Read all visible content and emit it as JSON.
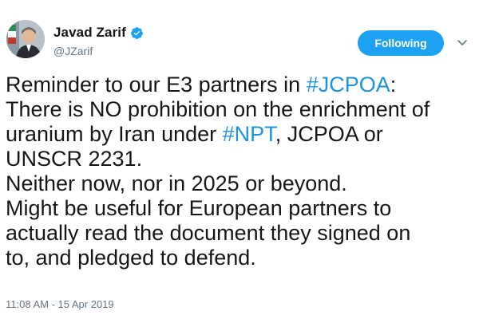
{
  "author": {
    "name": "Javad Zarif",
    "handle": "@JZarif",
    "verified": true,
    "avatar_icon": "profile-photo"
  },
  "follow_button": {
    "label": "Following",
    "color": "#1da1f2"
  },
  "menu_icon": "chevron-down-icon",
  "tweet": {
    "lines": [
      [
        {
          "text": "Reminder to our E3 partners in "
        },
        {
          "text": "#JCPOA",
          "hashtag": true
        },
        {
          "text": ":"
        }
      ],
      [
        {
          "text": "There is NO prohibition on the enrichment of"
        }
      ],
      [
        {
          "text": "uranium by Iran under "
        },
        {
          "text": "#NPT",
          "hashtag": true
        },
        {
          "text": ", JCPOA or"
        }
      ],
      [
        {
          "text": "UNSCR 2231."
        }
      ],
      [
        {
          "text": "Neither now, nor in 2025 or beyond."
        }
      ],
      [
        {
          "text": "Might be useful for European partners to"
        }
      ],
      [
        {
          "text": "actually read the document they signed on"
        }
      ],
      [
        {
          "text": "to, and pledged to defend."
        }
      ]
    ],
    "hashtag_color": "#1b95e0"
  },
  "timestamp": "11:08 AM - 15 Apr 2019"
}
